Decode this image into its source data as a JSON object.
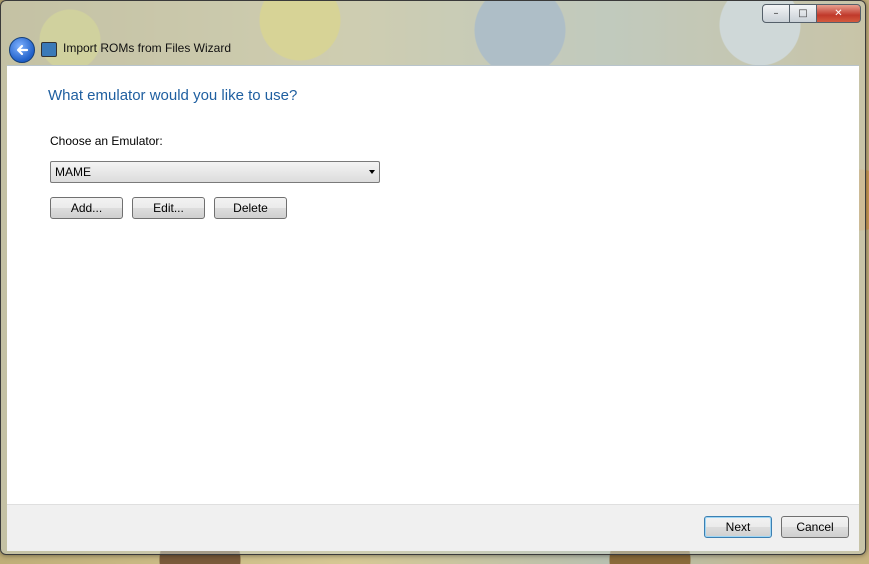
{
  "window": {
    "title": "Import ROMs from Files Wizard",
    "caption": {
      "minimize": "–",
      "maximize": "□",
      "close": "✕"
    }
  },
  "page": {
    "heading": "What emulator would you like to use?",
    "choose_label": "Choose an Emulator:",
    "emulator_selected": "MAME",
    "buttons": {
      "add": "Add...",
      "edit": "Edit...",
      "delete": "Delete"
    }
  },
  "footer": {
    "next": "Next",
    "cancel": "Cancel"
  },
  "icons": {
    "back": "back-arrow-icon",
    "app": "app-icon",
    "dropdown": "chevron-down-icon"
  },
  "colors": {
    "heading": "#1f5fa0",
    "back_button": "#1f5fc8",
    "close_button": "#c0392b"
  }
}
